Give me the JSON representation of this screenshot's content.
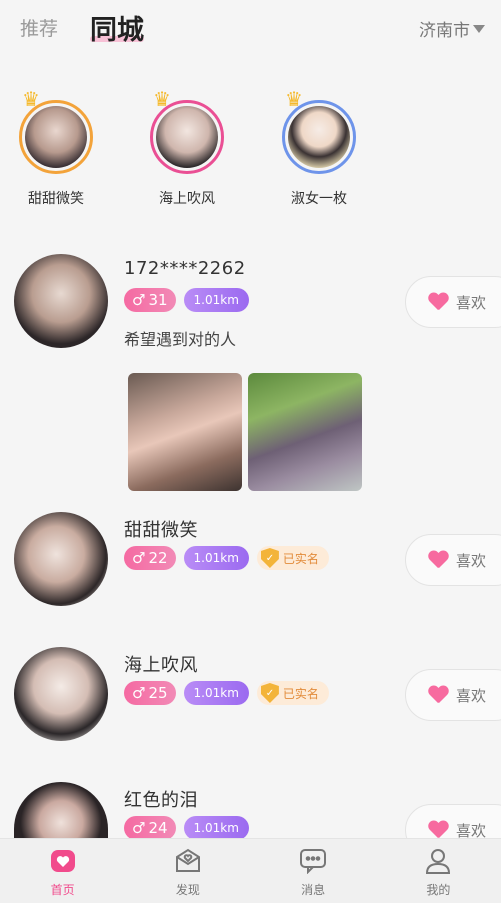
{
  "header": {
    "tabs": [
      {
        "label": "推荐"
      },
      {
        "label": "同城"
      }
    ],
    "city": "济南市"
  },
  "featured": [
    {
      "name": "甜甜微笑",
      "ring_color": "#f3a33a"
    },
    {
      "name": "海上吹风",
      "ring_color": "#ea4f94"
    },
    {
      "name": "淑女一枚",
      "ring_color": "#6e94ea"
    }
  ],
  "users": [
    {
      "name": "172****2262",
      "age": "31",
      "distance": "1.01km",
      "bio": "希望遇到对的人",
      "verified": "",
      "like_label": "喜欢"
    },
    {
      "name": "甜甜微笑",
      "age": "22",
      "distance": "1.01km",
      "verified": "已实名",
      "like_label": "喜欢"
    },
    {
      "name": "海上吹风",
      "age": "25",
      "distance": "1.01km",
      "verified": "已实名",
      "like_label": "喜欢"
    },
    {
      "name": "红色的泪",
      "age": "24",
      "distance": "1.01km",
      "verified": "",
      "like_label": "喜欢"
    }
  ],
  "gender_symbol": "♂",
  "bottom_nav": [
    {
      "label": "首页",
      "icon": "home-heart-icon"
    },
    {
      "label": "发现",
      "icon": "discover-envelope-icon"
    },
    {
      "label": "消息",
      "icon": "message-bubble-icon"
    },
    {
      "label": "我的",
      "icon": "profile-person-icon"
    }
  ],
  "colors": {
    "accent": "#f14b8c",
    "distance": "#9b6af0",
    "verify": "#f3b43a"
  }
}
